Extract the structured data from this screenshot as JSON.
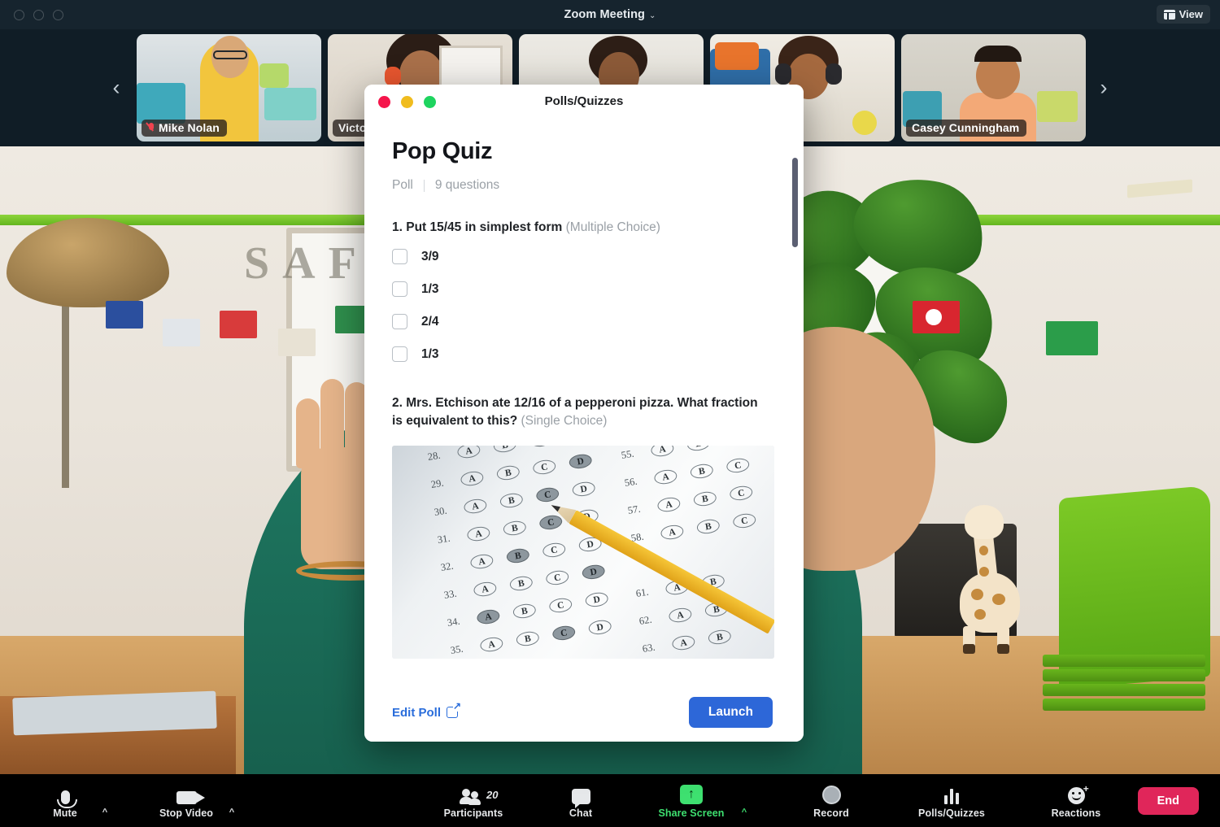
{
  "window": {
    "title": "Zoom Meeting",
    "chevron": "⌄",
    "view_label": "View",
    "view_icon": "layout-grid-icon"
  },
  "filmstrip": {
    "prev_icon": "chevron-left-icon",
    "next_icon": "chevron-right-icon",
    "participants": [
      {
        "name": "Mike Nolan",
        "muted": true
      },
      {
        "name": "Victo",
        "muted": false
      },
      {
        "name": "",
        "muted": false
      },
      {
        "name": "",
        "muted": false
      },
      {
        "name": "Casey Cunningham",
        "muted": false
      }
    ]
  },
  "modal": {
    "title": "Polls/Quizzes",
    "traffic_lights": [
      "#f5154b",
      "#f0bc1e",
      "#1ed45f"
    ],
    "poll_title": "Pop Quiz",
    "meta_type": "Poll",
    "meta_count": "9 questions",
    "questions": [
      {
        "text": "1. Put 15/45 in simplest form",
        "type": "(Multiple Choice)",
        "options": [
          "3/9",
          "1/3",
          "2/4",
          "1/3"
        ]
      },
      {
        "text": "2. Mrs. Etchison ate 12/16 of a pepperoni pizza. What fraction is equivalent to this?",
        "type": "(Single Choice)",
        "options": []
      }
    ],
    "image_alt": "scantron-answer-sheet-with-pencil",
    "scantron_rows": [
      {
        "num": "28.",
        "bubbles": [
          "A",
          "B",
          "C",
          "D"
        ],
        "filled": 2
      },
      {
        "num": "29.",
        "bubbles": [
          "A",
          "B",
          "C",
          "D"
        ],
        "filled": 3
      },
      {
        "num": "30.",
        "bubbles": [
          "A",
          "B",
          "C",
          "D"
        ],
        "filled": 2
      },
      {
        "num": "31.",
        "bubbles": [
          "A",
          "B",
          "C",
          "D"
        ],
        "filled": 2
      },
      {
        "num": "32.",
        "bubbles": [
          "A",
          "B",
          "C",
          "D"
        ],
        "filled": 1
      },
      {
        "num": "33.",
        "bubbles": [
          "A",
          "B",
          "C",
          "D"
        ],
        "filled": 3
      },
      {
        "num": "34.",
        "bubbles": [
          "A",
          "B",
          "C",
          "D"
        ],
        "filled": 0
      },
      {
        "num": "35.",
        "bubbles": [
          "A",
          "B",
          "C",
          "D"
        ],
        "filled": 2
      }
    ],
    "edit_label": "Edit Poll",
    "edit_icon": "external-link-icon",
    "launch_label": "Launch",
    "launch_color": "#2d67d8"
  },
  "toolbar": {
    "items": [
      {
        "label": "Mute",
        "icon": "microphone-icon",
        "caret": "^",
        "active": false
      },
      {
        "label": "Stop Video",
        "icon": "video-camera-icon",
        "caret": "^",
        "active": false
      },
      {
        "label": "Participants",
        "icon": "people-icon",
        "count": "20",
        "active": false
      },
      {
        "label": "Chat",
        "icon": "speech-bubble-icon",
        "active": false
      },
      {
        "label": "Share Screen",
        "icon": "share-arrow-up-icon",
        "caret": "^",
        "active": true
      },
      {
        "label": "Record",
        "icon": "record-circle-icon",
        "active": false
      },
      {
        "label": "Polls/Quizzes",
        "icon": "bar-chart-icon",
        "active": false
      },
      {
        "label": "Reactions",
        "icon": "smiley-plus-icon",
        "active": false
      }
    ],
    "end_label": "End",
    "end_color": "#e0265a",
    "active_color": "#3ee070"
  }
}
